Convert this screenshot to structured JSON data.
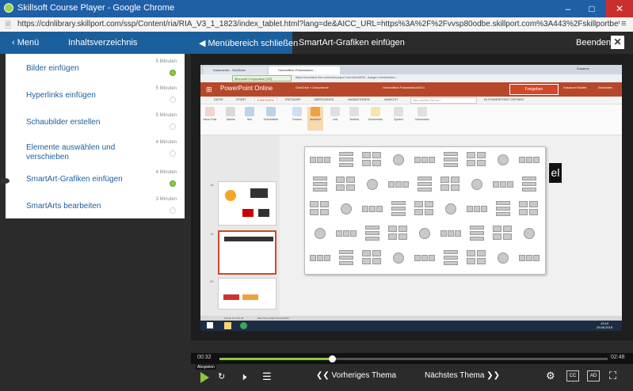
{
  "window": {
    "title": "Skillsoft Course Player - Google Chrome",
    "url": "https://cdnlibrary.skillport.com/ssp/Content/ria/RIA_V3_1_1823/index_tablet.html?lang=de&AICC_URL=https%3A%2F%2Fvvsp80odbe.skillport.com%3A443%2Fskillportbe%2Fs..."
  },
  "header": {
    "menu_label": "Menü",
    "toc_label": "Inhaltsverzeichnis",
    "close_menu_label": "Menübereich schließen",
    "current_topic": "SmartArt-Grafiken einfügen",
    "exit_label": "Beenden"
  },
  "topics": [
    {
      "label": "Bilder einfügen",
      "duration": "5 Minuten",
      "status": "done"
    },
    {
      "label": "Hyperlinks einfügen",
      "duration": "5 Minuten",
      "status": "todo"
    },
    {
      "label": "Schaubilder erstellen",
      "duration": "5 Minuten",
      "status": "todo"
    },
    {
      "label": "Elemente auswählen und verschieben",
      "duration": "4 Minuten",
      "status": "todo"
    },
    {
      "label": "SmartArt-Grafiken einfügen",
      "duration": "4 Minuten",
      "status": "done",
      "current": true
    },
    {
      "label": "SmartArts bearbeiten",
      "duration": "3 Minuten",
      "status": "todo"
    }
  ],
  "video": {
    "browser_tabs": [
      "Dokumente - OneDrive",
      "Homeoffice-Präsentation..."
    ],
    "ev_label": "Microsoft Corporation [US]",
    "url": "https://onedrive.live.com/view.aspx?cid=68c3493f...&page=view&resid=...",
    "app_name": "PowerPoint Online",
    "breadcrumb": "OneDrive » Dokumente",
    "doc_name": "Homeoffice-Präsentation2014",
    "share_label": "Freigeben",
    "user_name": "Susanne Richter",
    "signout_label": "Abmelden",
    "ribbon_tabs": [
      "DATEI",
      "START",
      "EINFÜGEN",
      "ENTWURF",
      "ÜBERGÄNGE",
      "ANIMATIONEN",
      "ANSICHT"
    ],
    "tell_me": "Was möchten Sie tun?",
    "open_in_app": "IN POWERPOINT ÖFFNEN",
    "ribbon_buttons": [
      "Neue Folie",
      "Tabelle",
      "Bild",
      "Onlinebilder",
      "Formen",
      "SmartArt",
      "Link",
      "Textfeld",
      "Kommentar",
      "Symbol",
      "Onlinevideo"
    ],
    "slide_numbers": [
      "14",
      "15",
      "20"
    ],
    "slide_counter": "el",
    "status_text": "FOLIE 15 VON 25",
    "status_language": "DEUTSCH (DEUTSCHLAND)",
    "clock_time": "13:10",
    "clock_date": "29.06.2015"
  },
  "player": {
    "elapsed": "00:32",
    "total": "02:48",
    "progress": 0.29,
    "play_tooltip": "Abspielen",
    "prev_topic": "Vorheriges Thema",
    "next_topic": "Nächstes Thema",
    "cc_label": "CC",
    "ad_label": "AD"
  }
}
